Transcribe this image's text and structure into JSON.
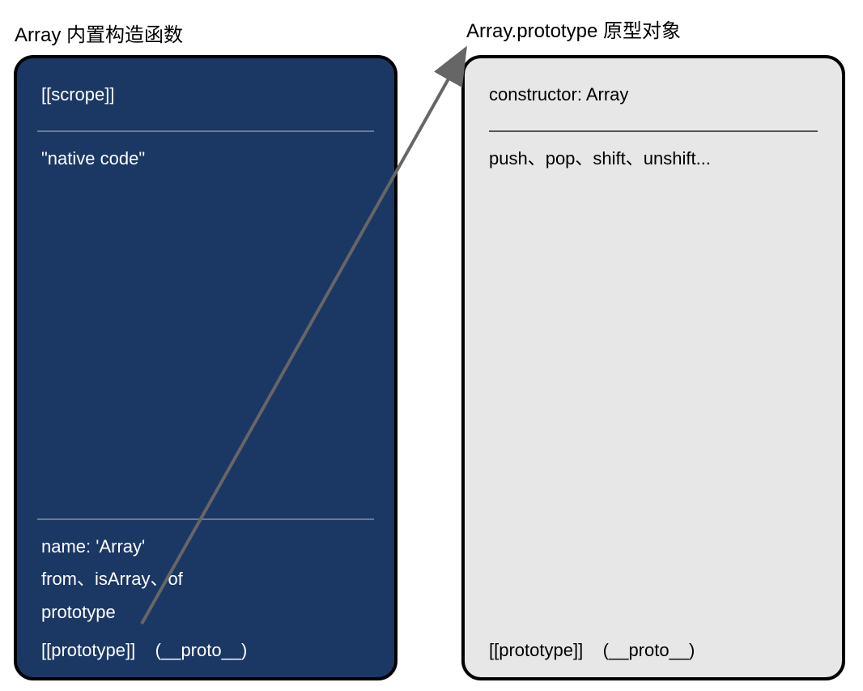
{
  "titles": {
    "left": "Array 内置构造函数",
    "right": "Array.prototype 原型对象"
  },
  "left": {
    "scope": "[[scrope]]",
    "native": "\"native code\"",
    "name": "name: 'Array'",
    "staticMethods": "from、isArray、of",
    "prototype": "prototype",
    "protoLabel": "[[prototype]]",
    "protoAlias": "(__proto__)"
  },
  "right": {
    "constructor": "constructor: Array",
    "methods": "push、pop、shift、unshift...",
    "protoLabel": "[[prototype]]",
    "protoAlias": "(__proto__)"
  },
  "colors": {
    "leftBg": "#1b3864",
    "rightBg": "#e7e7e7",
    "arrow": "#666666"
  }
}
